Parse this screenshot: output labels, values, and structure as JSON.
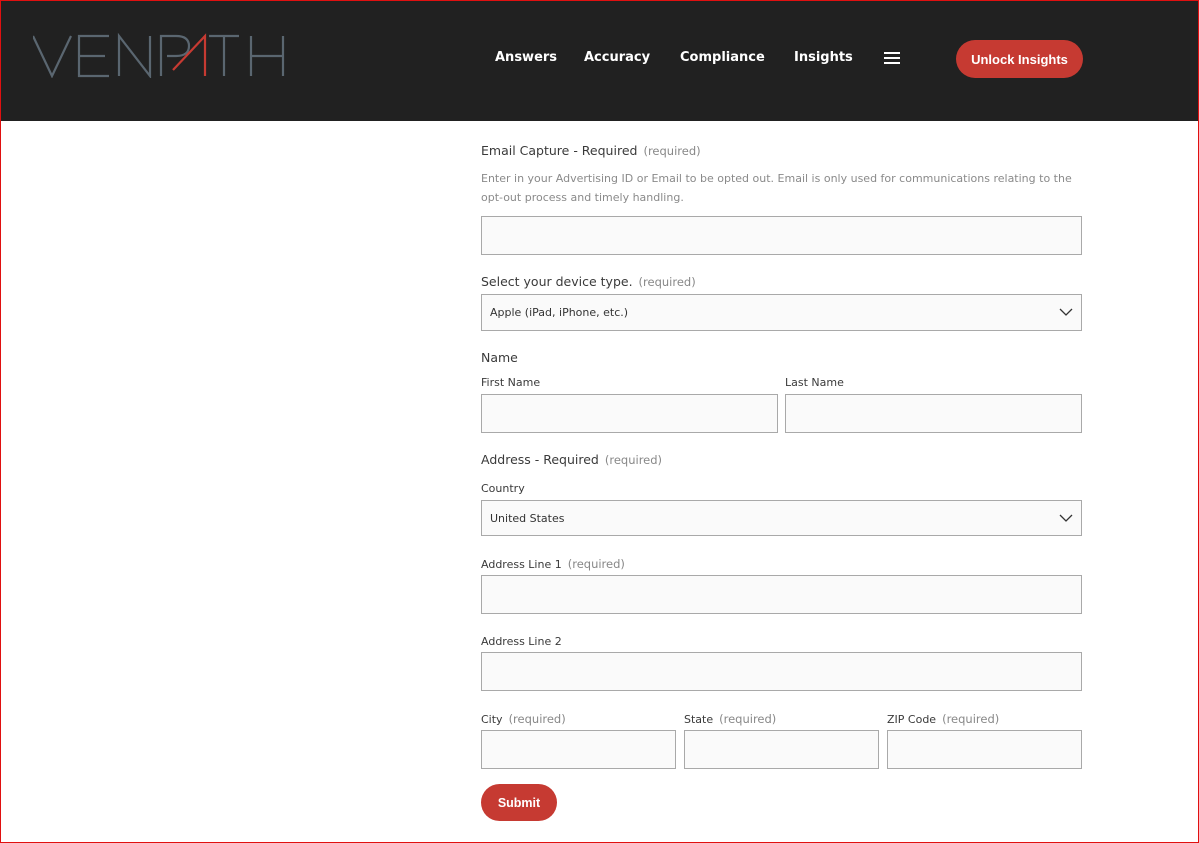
{
  "header": {
    "logo_text": "VENPATH",
    "nav": [
      {
        "label": "Answers"
      },
      {
        "label": "Accuracy"
      },
      {
        "label": "Compliance"
      },
      {
        "label": "Insights"
      }
    ],
    "menu_icon": "hamburger-icon",
    "cta_label": "Unlock Insights"
  },
  "form": {
    "email": {
      "label": "Email Capture - Required",
      "required": "(required)",
      "description": "Enter in your Advertising ID or Email to be opted out. Email is only used for communications relating to the opt-out process and timely handling.",
      "value": ""
    },
    "device": {
      "label": "Select your device type.",
      "required": "(required)",
      "selected": "Apple (iPad, iPhone, etc.)"
    },
    "name": {
      "label": "Name",
      "first_label": "First Name",
      "first_value": "",
      "last_label": "Last Name",
      "last_value": ""
    },
    "address": {
      "label": "Address - Required",
      "required": "(required)",
      "country_label": "Country",
      "country_selected": "United States",
      "line1_label": "Address Line 1",
      "line1_required": "(required)",
      "line1_value": "",
      "line2_label": "Address Line 2",
      "line2_value": "",
      "city_label": "City",
      "city_required": "(required)",
      "city_value": "",
      "state_label": "State",
      "state_required": "(required)",
      "state_value": "",
      "zip_label": "ZIP Code",
      "zip_required": "(required)",
      "zip_value": ""
    },
    "submit_label": "Submit"
  },
  "colors": {
    "header_bg": "#212121",
    "accent": "#c63a32",
    "logo_gray": "#5a6670"
  }
}
